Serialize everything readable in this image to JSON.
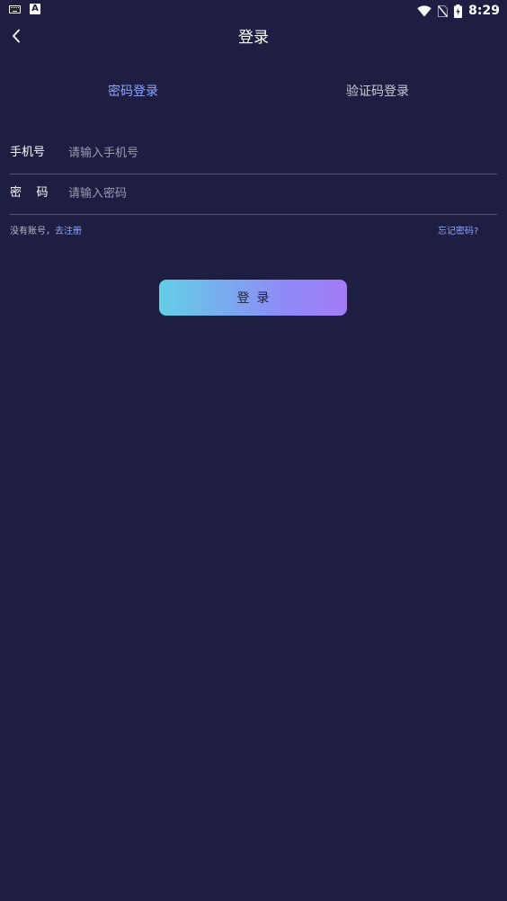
{
  "status_bar": {
    "time": "8:29",
    "icons": [
      "keyboard-icon",
      "a-notification-icon",
      "wifi-icon",
      "no-sim-icon",
      "battery-charging-icon"
    ],
    "a_glyph": "A"
  },
  "header": {
    "title": "登录",
    "back_icon": "chevron-left-icon"
  },
  "tabs": [
    {
      "label": "密码登录",
      "active": true
    },
    {
      "label": "验证码登录",
      "active": false
    }
  ],
  "form": {
    "phone": {
      "label": "手机号",
      "placeholder": "请输入手机号",
      "value": ""
    },
    "password": {
      "label": "密    码",
      "placeholder": "请输入密码",
      "value": ""
    }
  },
  "links": {
    "register_prefix": "没有账号，",
    "register": "去注册",
    "forgot": "忘记密码?"
  },
  "login_button": {
    "label": "登录"
  },
  "colors": {
    "background": "#1e1e42",
    "accent": "#8ea6ff",
    "button_gradient_start": "#63cfe6",
    "button_gradient_end": "#a57af8"
  }
}
